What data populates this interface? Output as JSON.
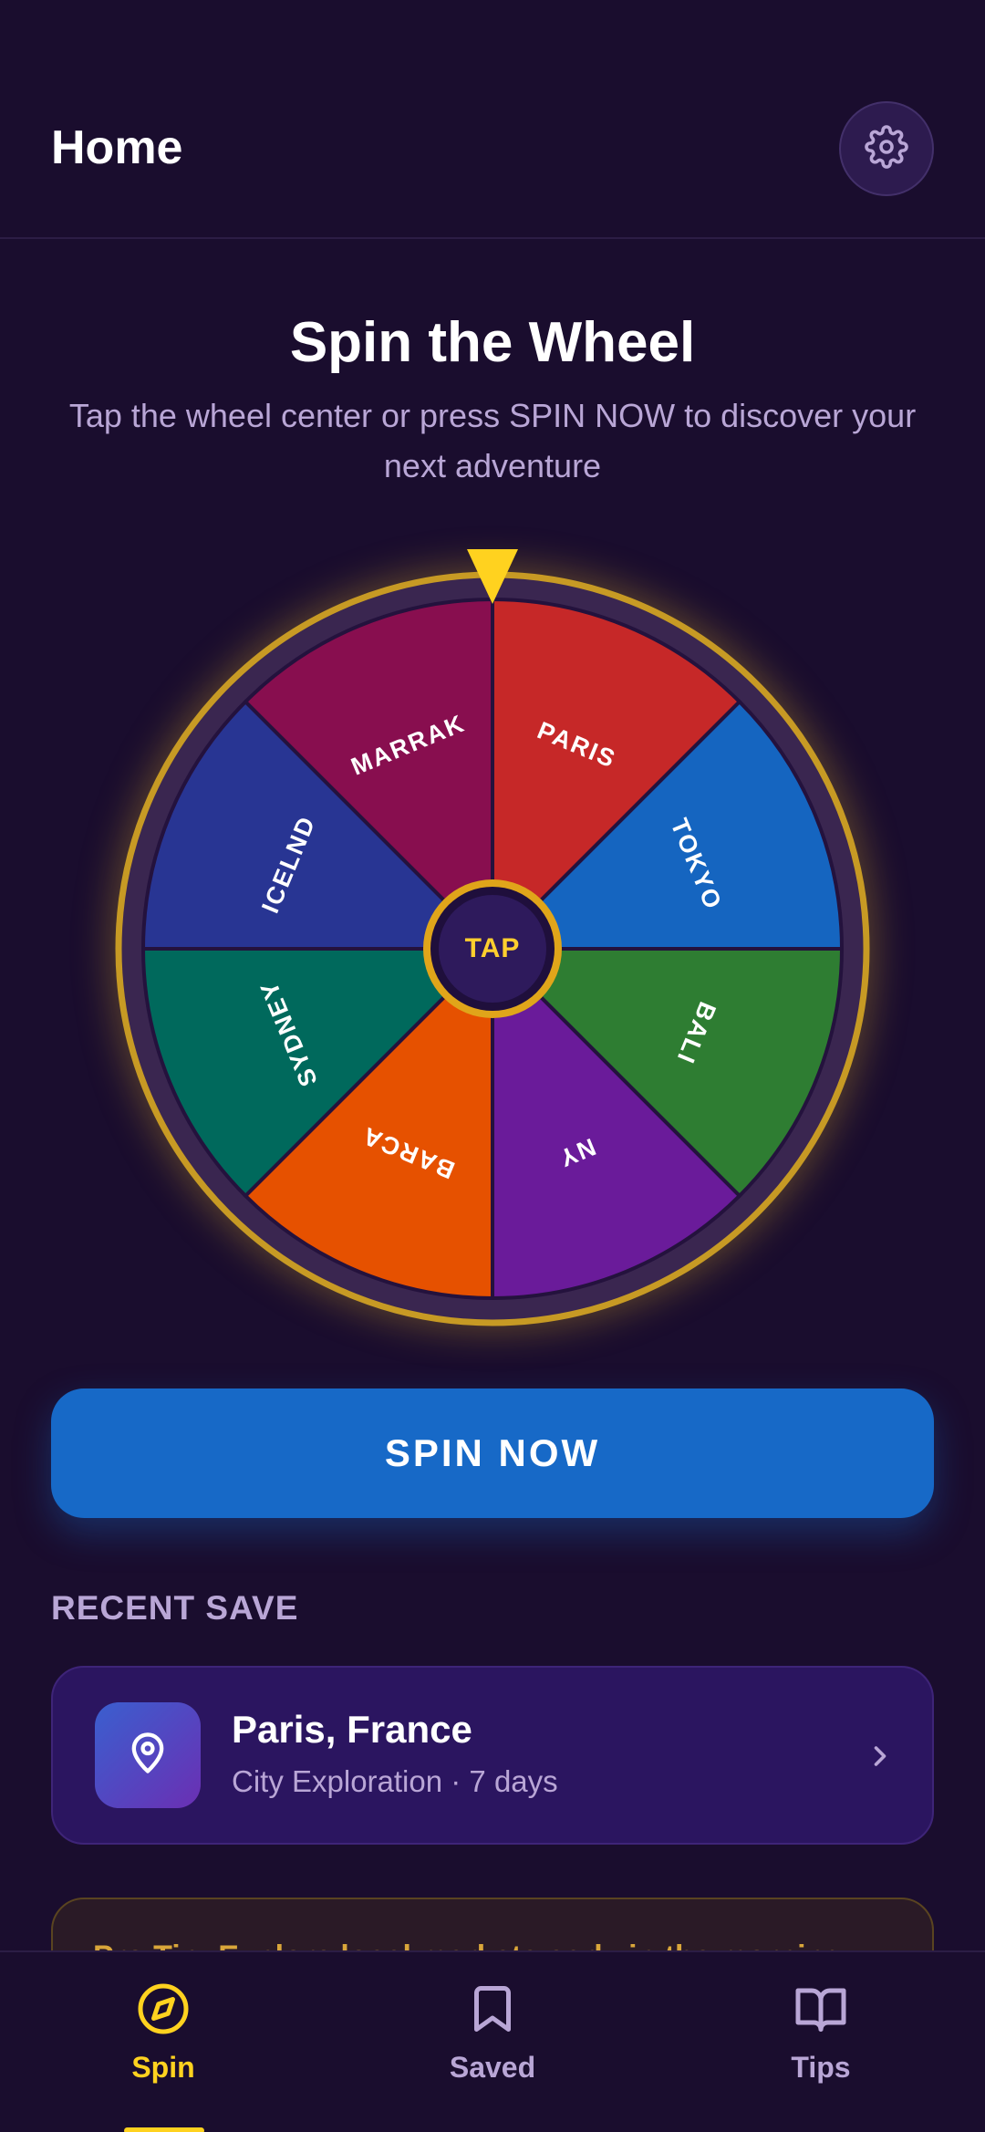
{
  "header": {
    "title": "Home",
    "settings_icon": "gear-icon"
  },
  "hero": {
    "title": "Spin the Wheel",
    "subtitle": "Tap the wheel center or press SPIN NOW to discover your next adventure"
  },
  "wheel": {
    "hub_label": "TAP",
    "ring_color": "#c79a24",
    "pointer_color": "#ffd21f",
    "segments": [
      {
        "label": "PARIS",
        "color": "#c62828"
      },
      {
        "label": "TOKYO",
        "color": "#1565c0"
      },
      {
        "label": "BALI",
        "color": "#2e7d32"
      },
      {
        "label": "NY",
        "color": "#6a1b9a"
      },
      {
        "label": "BARCA",
        "color": "#e65100"
      },
      {
        "label": "SYDNEY",
        "color": "#00695c"
      },
      {
        "label": "ICELND",
        "color": "#283593"
      },
      {
        "label": "MARRAK",
        "color": "#880e4f"
      }
    ]
  },
  "spin_button": {
    "label": "SPIN NOW"
  },
  "recent": {
    "section_label": "RECENT SAVE",
    "title": "Paris, France",
    "subtitle": "City Exploration · 7 days",
    "icon": "map-pin-icon"
  },
  "tip": {
    "text": "Pro Tip: Explore local markets early in the morning"
  },
  "nav": {
    "items": [
      {
        "label": "Spin",
        "icon": "compass-icon",
        "active": true
      },
      {
        "label": "Saved",
        "icon": "bookmark-icon",
        "active": false
      },
      {
        "label": "Tips",
        "icon": "book-icon",
        "active": false
      }
    ],
    "active_color": "#ffd21f",
    "inactive_color": "#b9a6d6"
  }
}
